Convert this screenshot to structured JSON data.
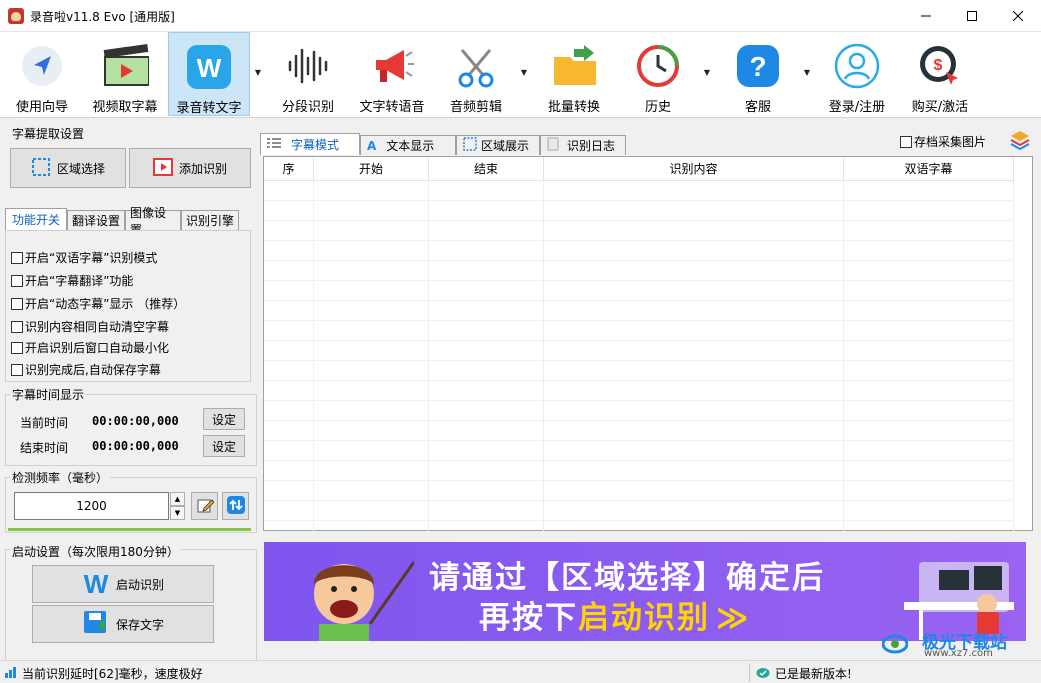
{
  "window": {
    "title": "录音啦v11.8 Evo [通用版]"
  },
  "toolbar": {
    "items": [
      {
        "label": "使用向导",
        "icon": "navigation-arrow-icon"
      },
      {
        "label": "视频取字幕",
        "icon": "film-clapper-icon"
      },
      {
        "label": "录音转文字",
        "icon": "w-word-icon"
      },
      {
        "label": "分段识别",
        "icon": "waveform-icon"
      },
      {
        "label": "文字转语音",
        "icon": "megaphone-icon"
      },
      {
        "label": "音频剪辑",
        "icon": "scissors-icon"
      },
      {
        "label": "批量转换",
        "icon": "folder-arrow-icon"
      },
      {
        "label": "历史",
        "icon": "clock-history-icon"
      },
      {
        "label": "客服",
        "icon": "question-icon"
      },
      {
        "label": "登录/注册",
        "icon": "user-icon"
      },
      {
        "label": "购买/激活",
        "icon": "dollar-cursor-icon"
      }
    ]
  },
  "extract": {
    "title": "字幕提取设置",
    "region_btn": "区域选择",
    "add_btn": "添加识别"
  },
  "settings_tabs": [
    "功能开关",
    "翻译设置",
    "图像设置",
    "识别引擎"
  ],
  "options": [
    "开启“双语字幕”识别模式",
    "开启“字幕翻译”功能",
    "开启“动态字幕”显示 （推荐）",
    "识别内容相同自动清空字幕",
    "开启识别后窗口自动最小化",
    "识别完成后,自动保存字幕"
  ],
  "timing": {
    "title": "字幕时间显示",
    "current_label": "当前时间",
    "current_value": "00:00:00,000",
    "end_label": "结束时间",
    "end_value": "00:00:00,000",
    "set_btn": "设定"
  },
  "freq": {
    "title": "检测频率（毫秒）",
    "value": "1200"
  },
  "startup": {
    "title": "启动设置（每次限用180分钟）",
    "start_btn": "启动识别",
    "save_btn": "保存文字"
  },
  "main_tabs": [
    "字幕模式",
    "文本显示",
    "区域展示",
    "识别日志"
  ],
  "archive_label": "存档采集图片",
  "columns": [
    "序",
    "开始",
    "结束",
    "识别内容",
    "双语字幕"
  ],
  "banner": {
    "line1": "请通过【区域选择】确定后",
    "line2a": "再按下",
    "line2b": "启动识别",
    "line2c": "≫"
  },
  "watermark": {
    "brand": "极光下载站",
    "url": "www.xz7.com"
  },
  "status": {
    "left": "当前识别延时[62]毫秒，速度极好",
    "right": "已是最新版本!"
  },
  "colors": {
    "accent": "#0b5fbd",
    "banner_bg": "#8a5cf0",
    "banner_yellow": "#ffd400",
    "progress_green": "#8bc34a"
  }
}
